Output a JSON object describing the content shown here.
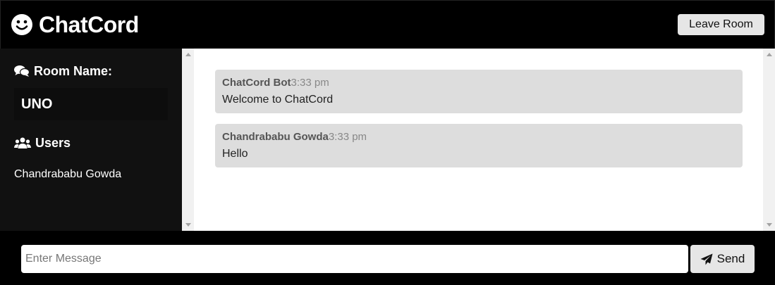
{
  "header": {
    "brand_icon": "smiley-icon",
    "title": "ChatCord",
    "leave_label": "Leave Room"
  },
  "sidebar": {
    "room_heading_icon": "comments-icon",
    "room_heading": "Room Name:",
    "room_name": "UNO",
    "users_heading_icon": "users-icon",
    "users_heading": "Users",
    "users": [
      "Chandrababu Gowda"
    ]
  },
  "messages": [
    {
      "user": "ChatCord Bot",
      "time": "3:33 pm",
      "text": "Welcome to ChatCord"
    },
    {
      "user": "Chandrababu Gowda",
      "time": "3:33 pm",
      "text": "Hello"
    }
  ],
  "composer": {
    "placeholder": "Enter Message",
    "value": "",
    "send_icon": "paper-plane-icon",
    "send_label": "Send"
  },
  "colors": {
    "header_bg": "#000000",
    "sidebar_bg": "#111111",
    "message_bg": "#dddddd",
    "button_bg": "#e6e6e6"
  }
}
